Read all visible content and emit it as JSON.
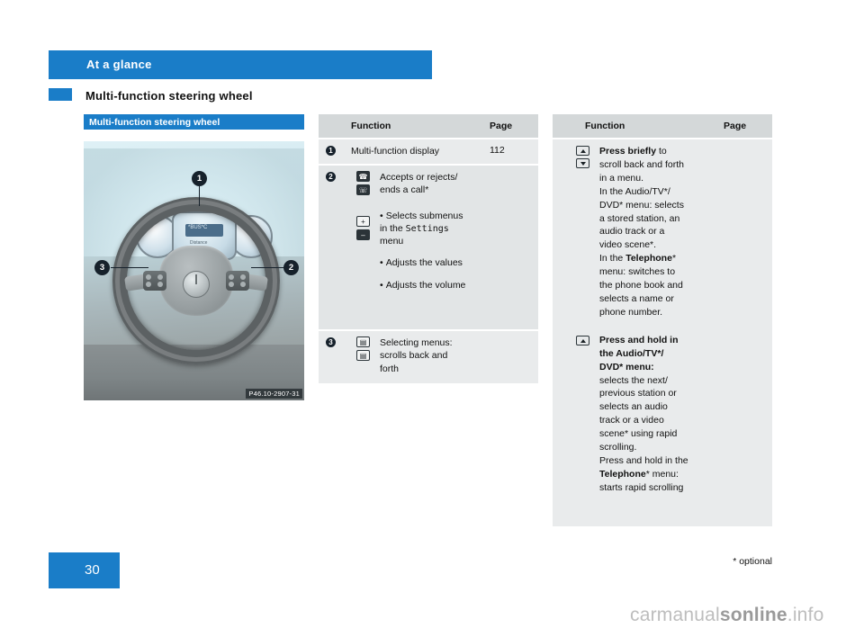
{
  "header": {
    "chapter_title": "At a glance",
    "section_title": "Multi-function steering wheel",
    "bar_color": "#1a7dc8"
  },
  "figure": {
    "caption": "Multi-function steering wheel",
    "photo_code": "P46.10-2907-31",
    "callouts": [
      "1",
      "2",
      "3"
    ],
    "cluster_display_text": "*BUS*C",
    "cluster_sub_text": "Distance"
  },
  "tables": [
    {
      "id": "middle",
      "columns": {
        "function": "Function",
        "page": "Page"
      },
      "rows": [
        {
          "num": "1",
          "body": "Multi-function display",
          "page": "112"
        },
        {
          "num": "2",
          "body_lines": [
            "Accepts or rejects/",
            "ends a call*"
          ],
          "bullets": [
            "Selects submenus in the Settings menu",
            "Adjusts the values",
            "Adjusts the volume"
          ],
          "settings_word": "Settings",
          "page": ""
        },
        {
          "num": "3",
          "body_lines": [
            "Selecting menus:",
            "scrolls back and",
            "forth"
          ],
          "page": ""
        }
      ]
    },
    {
      "id": "right",
      "columns": {
        "function": "Function",
        "page": "Page"
      },
      "blocks": [
        {
          "lead_bold": "Press briefly",
          "lead_rest": " to",
          "lines": [
            "scroll back and forth",
            "in a menu.",
            "In the Audio/TV*/",
            "DVD* menu: selects",
            "a stored station, an",
            "audio track or a",
            "video scene*.",
            "In the Telephone*",
            "menu: switches to",
            "the phone book and",
            "selects a name or",
            "phone number."
          ],
          "bold_terms": [
            "Telephone"
          ]
        },
        {
          "lead_bold": "Press and hold in",
          "lead_rest": "",
          "lines": [
            "the Audio/TV*/",
            "DVD* menu:",
            "selects the next/",
            "previous station or",
            "selects an audio",
            "track or a video",
            "scene* using rapid",
            "scrolling.",
            "Press and hold in the",
            "Telephone* menu:",
            "starts rapid scrolling"
          ],
          "bold_lines": [
            "the Audio/TV*/",
            "DVD* menu:"
          ],
          "bold_terms": [
            "Telephone"
          ]
        }
      ]
    }
  ],
  "footer": {
    "page_number": "30",
    "footnote": "* optional",
    "watermark_light": "carmanual",
    "watermark_bold": "sonline",
    "watermark_tail": ".info"
  }
}
